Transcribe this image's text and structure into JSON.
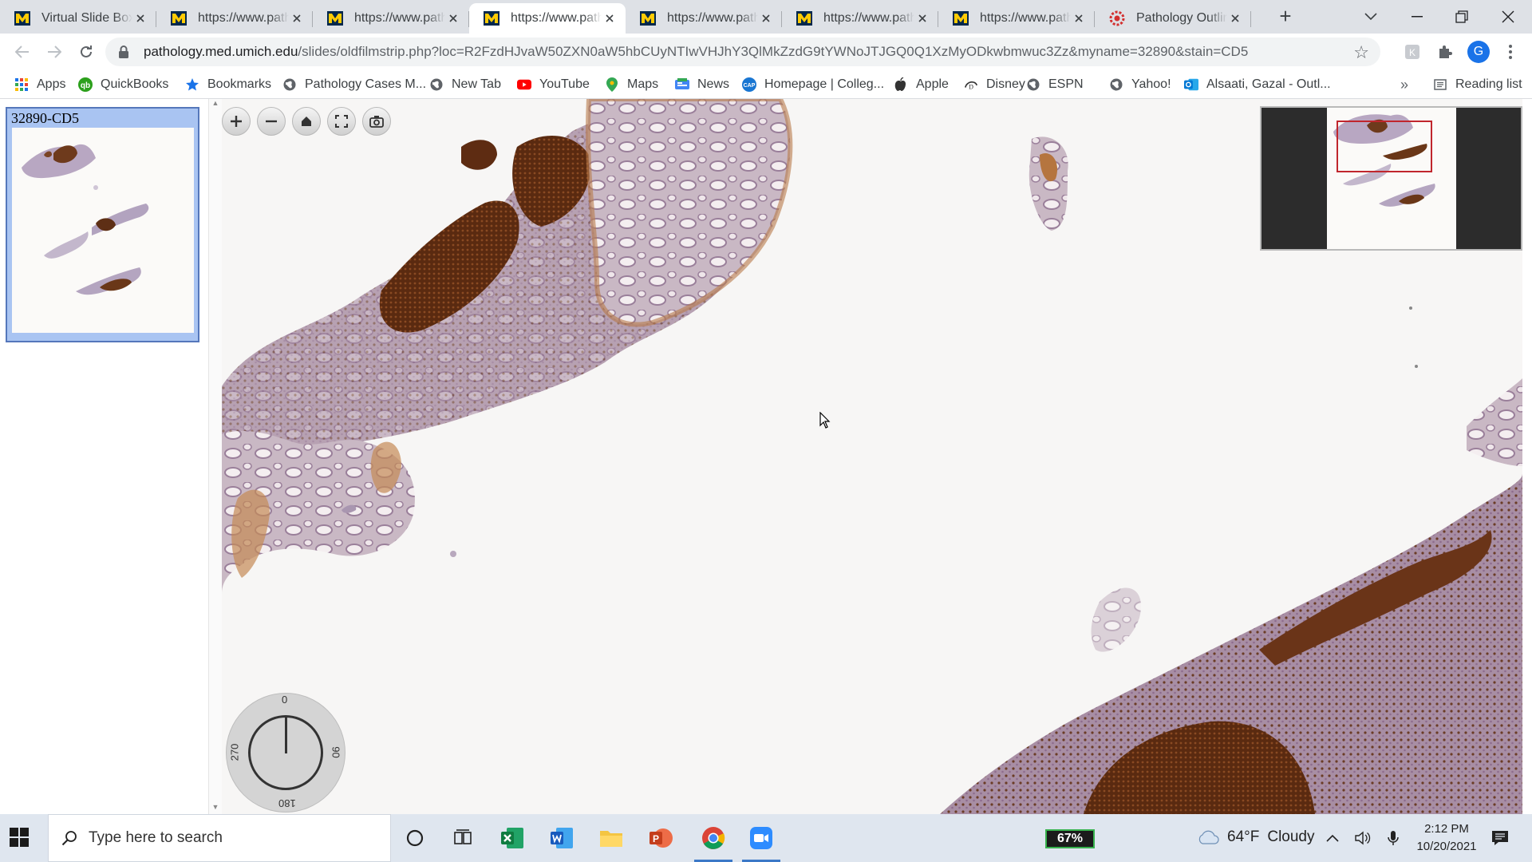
{
  "browser": {
    "tabs": [
      {
        "title": "Virtual Slide Box",
        "favicon": "umich-block-m-icon",
        "active": false
      },
      {
        "title": "https://www.path",
        "favicon": "umich-block-m-icon",
        "active": false
      },
      {
        "title": "https://www.path",
        "favicon": "umich-block-m-icon",
        "active": false
      },
      {
        "title": "https://www.path",
        "favicon": "umich-block-m-icon",
        "active": true
      },
      {
        "title": "https://www.path",
        "favicon": "umich-block-m-icon",
        "active": false
      },
      {
        "title": "https://www.path",
        "favicon": "umich-block-m-icon",
        "active": false
      },
      {
        "title": "https://www.path",
        "favicon": "umich-block-m-icon",
        "active": false
      },
      {
        "title": "Pathology Outlin",
        "favicon": "pathology-outlines-icon",
        "active": false
      }
    ],
    "address": {
      "host": "pathology.med.umich.edu",
      "path": "/slides/oldfilmstrip.php?loc=R2FzdHJvaW50ZXN0aW5hbCUyNTIwVHJhY3QlMkZzdG9tYWNoJTJGQ0Q1XzMyODkwbmwuc3Zz&myname=32890&stain=CD5"
    },
    "profile_initial": "G",
    "bookmarks": [
      {
        "label": "Apps",
        "icon": "apps-grid-icon"
      },
      {
        "label": "QuickBooks",
        "icon": "quickbooks-icon"
      },
      {
        "label": "Bookmarks",
        "icon": "star-icon"
      },
      {
        "label": "Pathology Cases M...",
        "icon": "globe-icon"
      },
      {
        "label": "New Tab",
        "icon": "globe-icon"
      },
      {
        "label": "YouTube",
        "icon": "youtube-icon"
      },
      {
        "label": "Maps",
        "icon": "maps-pin-icon"
      },
      {
        "label": "News",
        "icon": "news-icon"
      },
      {
        "label": "Homepage | Colleg...",
        "icon": "cap-icon"
      },
      {
        "label": "Apple",
        "icon": "apple-icon"
      },
      {
        "label": "Disney",
        "icon": "disney-icon"
      },
      {
        "label": "ESPN",
        "icon": "globe-icon"
      },
      {
        "label": "Yahoo!",
        "icon": "globe-icon"
      },
      {
        "label": "Alsaati, Gazal - Outl...",
        "icon": "outlook-icon"
      }
    ],
    "more_bookmarks": "»",
    "reading_list": "Reading list"
  },
  "viewer": {
    "filmstrip": {
      "items": [
        {
          "label": "32890-CD5",
          "selected": true
        }
      ]
    },
    "controls": [
      "zoom-in-icon",
      "zoom-out-icon",
      "home-icon",
      "fullscreen-icon",
      "screenshot-icon"
    ],
    "rotation": {
      "top": "0",
      "right": "90",
      "bottom": "180",
      "left": "270",
      "angle_deg": 0
    }
  },
  "taskbar": {
    "search_placeholder": "Type here to search",
    "battery": "67%",
    "weather_temp": "64°F",
    "weather_text": "Cloudy",
    "time": "2:12 PM",
    "date": "10/20/2021"
  },
  "colors": {
    "stain_brown": "#7a3f1c",
    "tissue_purple": "#b9aac6",
    "filmstrip_selected": "#a9c4f2",
    "overview_box": "#c0262d"
  }
}
